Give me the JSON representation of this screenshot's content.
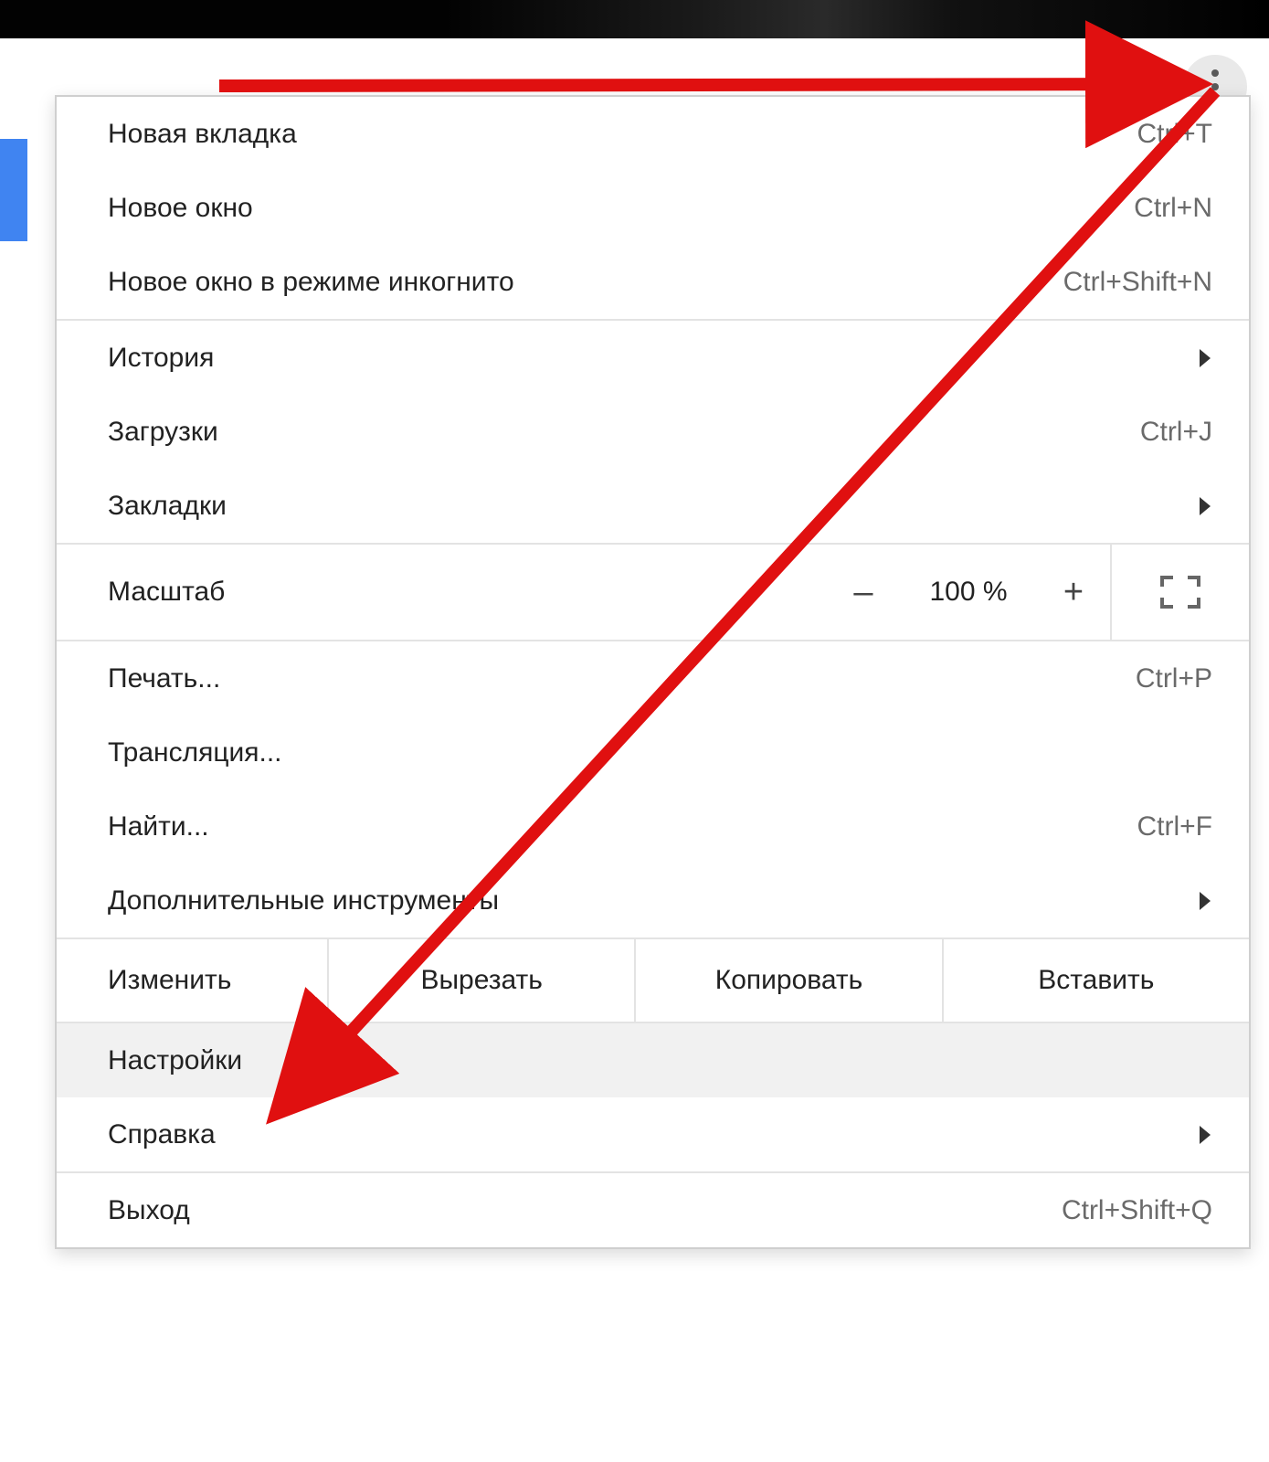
{
  "swatches": [
    "#d6d6d6",
    "#d0d0d0",
    "#d7d4cd",
    "#e4a3a8",
    "#e787a0",
    "#b7e0e1",
    "#e9b45b",
    "#c5c7c3",
    "#d4b58a",
    "#b6b6b6",
    "#bfbfbf",
    "#9a9a9a",
    "#8c8c8c"
  ],
  "menu": {
    "new_tab": {
      "label": "Новая вкладка",
      "shortcut": "Ctrl+T"
    },
    "new_window": {
      "label": "Новое окно",
      "shortcut": "Ctrl+N"
    },
    "new_incognito": {
      "label": "Новое окно в режиме инкогнито",
      "shortcut": "Ctrl+Shift+N"
    },
    "history": {
      "label": "История"
    },
    "downloads": {
      "label": "Загрузки",
      "shortcut": "Ctrl+J"
    },
    "bookmarks": {
      "label": "Закладки"
    },
    "zoom": {
      "label": "Масштаб",
      "value": "100 %",
      "minus": "–",
      "plus": "+"
    },
    "print": {
      "label": "Печать...",
      "shortcut": "Ctrl+P"
    },
    "cast": {
      "label": "Трансляция..."
    },
    "find": {
      "label": "Найти...",
      "shortcut": "Ctrl+F"
    },
    "more_tools": {
      "label": "Дополнительные инструменты"
    },
    "edit": {
      "label": "Изменить",
      "cut": "Вырезать",
      "copy": "Копировать",
      "paste": "Вставить"
    },
    "settings": {
      "label": "Настройки"
    },
    "help": {
      "label": "Справка"
    },
    "exit": {
      "label": "Выход",
      "shortcut": "Ctrl+Shift+Q"
    }
  }
}
